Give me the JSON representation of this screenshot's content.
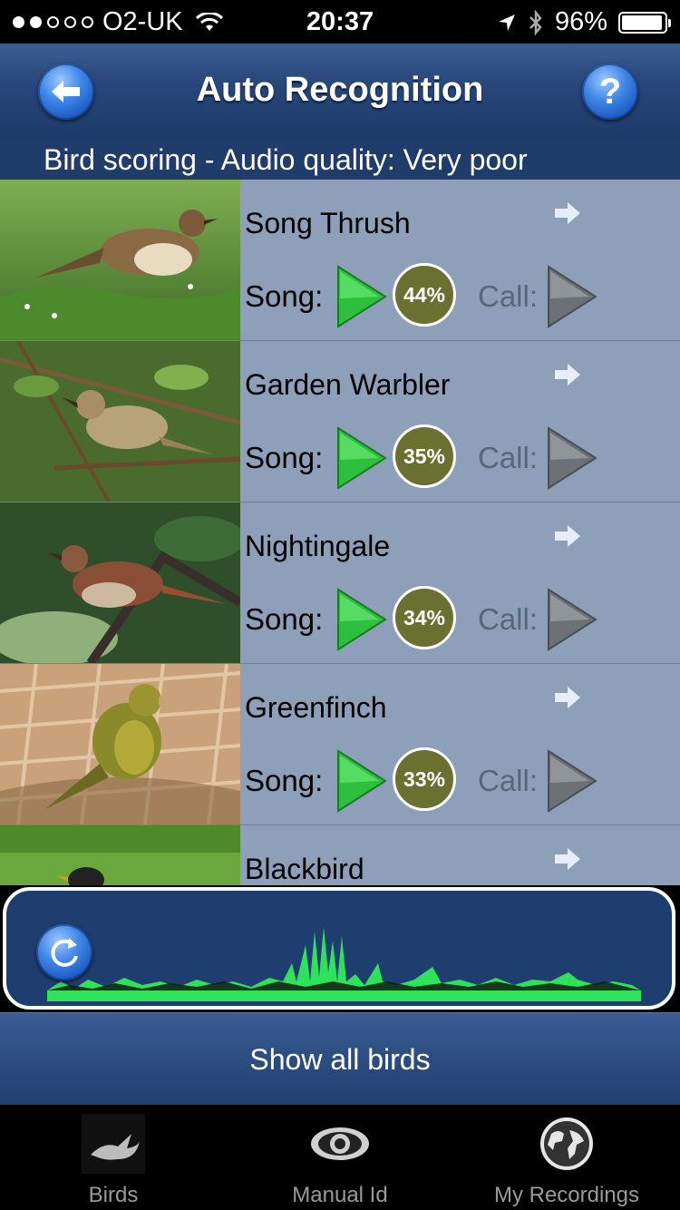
{
  "status": {
    "carrier": "O2-UK",
    "time": "20:37",
    "battery": "96%",
    "signal_bars": 2
  },
  "nav": {
    "title": "Auto Recognition",
    "help_label": "?"
  },
  "scoring": {
    "text": "Bird scoring - Audio quality: Very poor"
  },
  "birds": [
    {
      "name": "Song Thrush",
      "song_label": "Song:",
      "score": "44%",
      "call_label": "Call:"
    },
    {
      "name": "Garden Warbler",
      "song_label": "Song:",
      "score": "35%",
      "call_label": "Call:"
    },
    {
      "name": "Nightingale",
      "song_label": "Song:",
      "score": "34%",
      "call_label": "Call:"
    },
    {
      "name": "Greenfinch",
      "song_label": "Song:",
      "score": "33%",
      "call_label": "Call:"
    },
    {
      "name": "Blackbird"
    }
  ],
  "show_all": "Show all birds",
  "tabs": [
    {
      "label": "Birds",
      "icon": "bird-icon"
    },
    {
      "label": "Manual Id",
      "icon": "eye-icon"
    },
    {
      "label": "My Recordings",
      "icon": "globe-icon"
    }
  ],
  "colors": {
    "nav_blue": "#27467a",
    "list_bg": "#8e9fba",
    "score_olive": "#6a7030",
    "wave_green": "#2ee35a"
  }
}
